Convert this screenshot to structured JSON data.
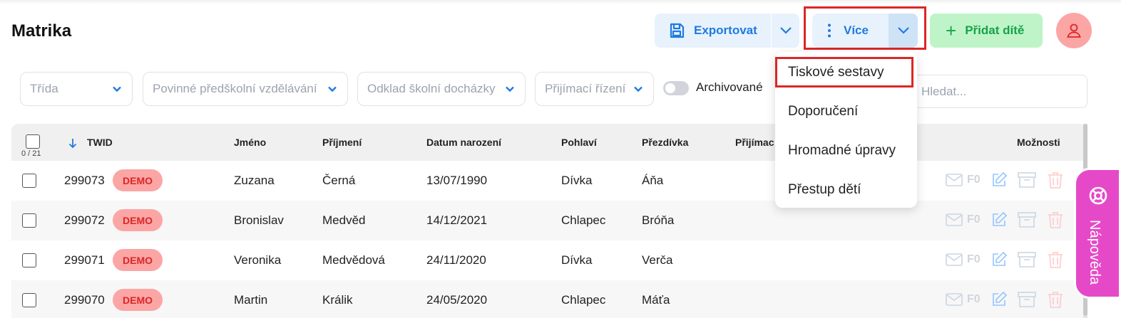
{
  "page": {
    "title": "Matrika"
  },
  "toolbar": {
    "export_label": "Exportovat",
    "more_label": "Více",
    "add_label": "Přidat dítě"
  },
  "filters": {
    "class": "Třída",
    "preschool": "Povinné předškolní vzdělávání",
    "deferral": "Odklad školní docházky",
    "admission": "Přijímací řízení",
    "archived_label": "Archivované",
    "search_placeholder": "Hledat..."
  },
  "more_menu": {
    "items": [
      "Tiskové sestavy",
      "Doporučení",
      "Hromadné úpravy",
      "Přestup dětí"
    ]
  },
  "table": {
    "selection_count": "0 / 21",
    "columns": [
      "TWID",
      "Jméno",
      "Příjmení",
      "Datum narození",
      "Pohlaví",
      "Přezdívka",
      "Přijímac",
      "Možnosti"
    ],
    "badge": "DEMO",
    "mail_label": "F0",
    "rows": [
      {
        "twid": "299073",
        "first": "Zuzana",
        "last": "Černá",
        "dob": "13/07/1990",
        "gender": "Dívka",
        "nick": "Áňa"
      },
      {
        "twid": "299072",
        "first": "Bronislav",
        "last": "Medvěd",
        "dob": "14/12/2021",
        "gender": "Chlapec",
        "nick": "Bróňa"
      },
      {
        "twid": "299071",
        "first": "Veronika",
        "last": "Medvědová",
        "dob": "24/11/2020",
        "gender": "Dívka",
        "nick": "Verča"
      },
      {
        "twid": "299070",
        "first": "Martin",
        "last": "Králik",
        "dob": "24/05/2020",
        "gender": "Chlapec",
        "nick": "Máťa"
      }
    ]
  },
  "help": {
    "label": "Nápověda"
  },
  "colors": {
    "accent": "#1f7ae0",
    "success": "#16a34a",
    "danger": "#dc2626",
    "help": "#e649c7"
  }
}
